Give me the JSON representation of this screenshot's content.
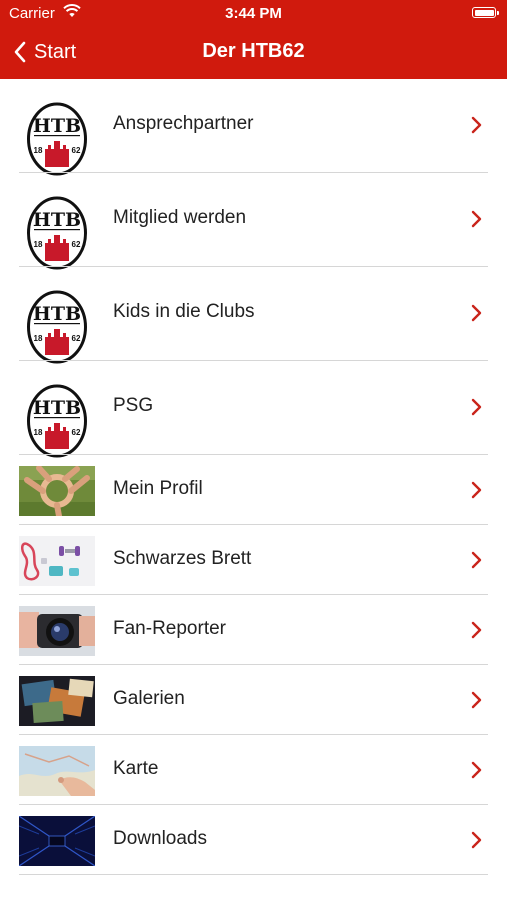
{
  "status_bar": {
    "carrier": "Carrier",
    "time": "3:44 PM"
  },
  "nav": {
    "back_label": "Start",
    "title": "Der HTB62"
  },
  "logo": {
    "letters": "HTB",
    "year_left": "18",
    "year_right": "62"
  },
  "colors": {
    "brand": "#d01a0d",
    "chevron": "#c9241b"
  },
  "items": [
    {
      "label": "Ansprechpartner",
      "icon": "htb-logo-icon"
    },
    {
      "label": "Mitglied werden",
      "icon": "htb-logo-icon"
    },
    {
      "label": "Kids in die Clubs",
      "icon": "htb-logo-icon"
    },
    {
      "label": "PSG",
      "icon": "htb-logo-icon"
    },
    {
      "label": "Mein Profil",
      "icon": "hands-photo-icon"
    },
    {
      "label": "Schwarzes Brett",
      "icon": "fitness-equipment-photo-icon"
    },
    {
      "label": "Fan-Reporter",
      "icon": "camera-photo-icon"
    },
    {
      "label": "Galerien",
      "icon": "photos-photo-icon"
    },
    {
      "label": "Karte",
      "icon": "map-photo-icon"
    },
    {
      "label": "Downloads",
      "icon": "data-tunnel-photo-icon"
    }
  ]
}
